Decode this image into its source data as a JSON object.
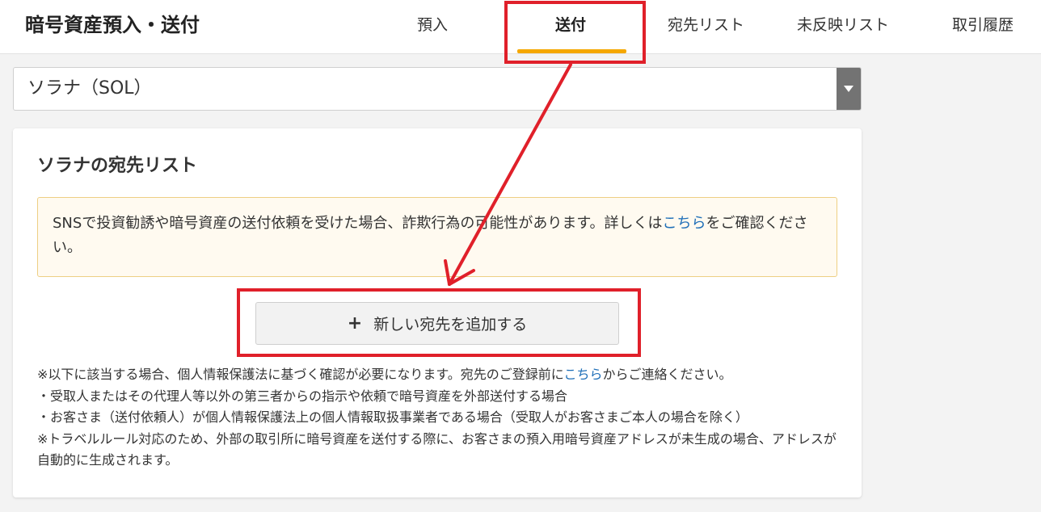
{
  "header": {
    "title": "暗号資産預入・送付",
    "tabs": [
      {
        "label": "預入"
      },
      {
        "label": "送付"
      },
      {
        "label": "宛先リスト"
      },
      {
        "label": "未反映リスト"
      },
      {
        "label": "取引履歴"
      }
    ],
    "active_tab": "送付",
    "accent_color": "#f5a800"
  },
  "currency_select": {
    "value": "ソラナ（SOL）",
    "arrow_icon": "triangle-down-icon"
  },
  "card": {
    "title": "ソラナの宛先リスト",
    "notice": {
      "text_before": "SNSで投資勧誘や暗号資産の送付依頼を受けた場合、詐欺行為の可能性があります。詳しくは",
      "link": "こちら",
      "text_after": "をご確認ください。"
    },
    "add_button": {
      "icon": "plus-icon",
      "label": "新しい宛先を追加する"
    },
    "notes": {
      "line1_before": "※以下に該当する場合、個人情報保護法に基づく確認が必要になります。宛先のご登録前に",
      "line1_link": "こちら",
      "line1_after": "からご連絡ください。",
      "line2": "・受取人またはその代理人等以外の第三者からの指示や依頼で暗号資産を外部送付する場合",
      "line3": "・お客さま（送付依頼人）が個人情報保護法上の個人情報取扱事業者である場合（受取人がお客さまご本人の場合を除く）",
      "line4": "※トラベルルール対応のため、外部の取引所に暗号資産を送付する際に、お客さまの預入用暗号資産アドレスが未生成の場合、アドレスが自動的に生成されます。"
    }
  },
  "annotation_color": "#e0202a"
}
